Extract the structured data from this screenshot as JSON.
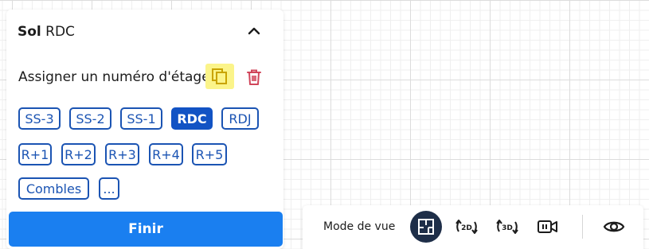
{
  "panel": {
    "title_bold": "Sol",
    "title_rest": "RDC",
    "collapse_icon": "chevron-up-icon",
    "assign_label": "Assigner un numéro d'étage",
    "copy_icon": "copy-icon",
    "delete_icon": "trash-icon",
    "floors": [
      {
        "label": "SS-3",
        "active": false
      },
      {
        "label": "SS-2",
        "active": false
      },
      {
        "label": "SS-1",
        "active": false
      },
      {
        "label": "RDC",
        "active": true
      },
      {
        "label": "RDJ",
        "active": false
      },
      {
        "label": "R+1",
        "active": false
      },
      {
        "label": "R+2",
        "active": false
      },
      {
        "label": "R+3",
        "active": false
      },
      {
        "label": "R+4",
        "active": false
      },
      {
        "label": "R+5",
        "active": false
      },
      {
        "label": "Combles",
        "active": false
      },
      {
        "label": "...",
        "active": false
      }
    ],
    "finish_label": "Finir"
  },
  "toolbar": {
    "mode_label": "Mode de vue",
    "views": [
      {
        "icon": "floorplan-icon",
        "label": "",
        "active": true
      },
      {
        "icon": "rotate-2d-icon",
        "label": "2D",
        "active": false
      },
      {
        "icon": "rotate-3d-icon",
        "label": "3D",
        "active": false
      },
      {
        "icon": "video-camera-icon",
        "label": "",
        "active": false
      },
      {
        "icon": "eye-icon",
        "label": "",
        "active": false
      }
    ]
  },
  "colors": {
    "primary": "#1A7FF0",
    "floor_blue": "#1B54B3",
    "active_floor": "#1253C4",
    "dark_view": "#1E2E48",
    "copy_highlight": "#FBF48A",
    "trash": "#D0455A"
  }
}
